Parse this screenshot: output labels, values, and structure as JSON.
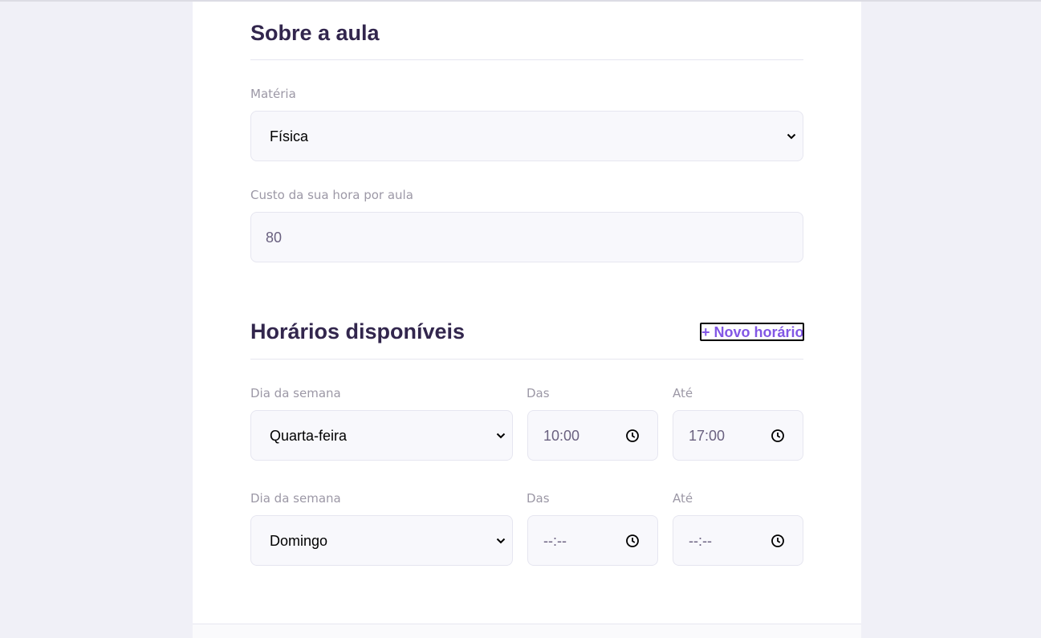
{
  "about": {
    "title": "Sobre a aula",
    "subject": {
      "label": "Matéria",
      "value": "Física"
    },
    "cost": {
      "label": "Custo da sua hora por aula",
      "value": "80"
    }
  },
  "schedule": {
    "title": "Horários disponíveis",
    "add_label": "+ Novo horário",
    "items": [
      {
        "day_label": "Dia da semana",
        "day_value": "Quarta-feira",
        "from_label": "Das",
        "from_value": "10:00",
        "to_label": "Até",
        "to_value": "17:00"
      },
      {
        "day_label": "Dia da semana",
        "day_value": "Domingo",
        "from_label": "Das",
        "from_value": "--:--",
        "to_label": "Até",
        "to_value": "--:--"
      }
    ]
  },
  "colors": {
    "title": "#32264d",
    "accent": "#8257e5",
    "label": "#9c98a6",
    "field_bg": "#f8f8fc",
    "page_bg": "#f0f0f7"
  },
  "icons": {
    "select_arrow": "chevron-down-icon",
    "time": "clock-icon"
  }
}
